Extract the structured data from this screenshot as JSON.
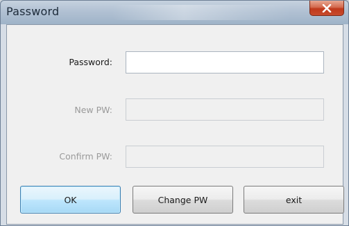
{
  "window": {
    "title": "Password"
  },
  "form": {
    "password_label": "Password:",
    "password_value": "",
    "new_pw_label": "New PW:",
    "new_pw_value": "",
    "confirm_pw_label": "Confirm PW:",
    "confirm_pw_value": ""
  },
  "buttons": {
    "ok": "OK",
    "change_pw": "Change PW",
    "exit": "exit"
  },
  "icons": {
    "close": "close-icon"
  },
  "colors": {
    "close_button": "#c0391b",
    "default_button_border": "#3c7fb1",
    "disabled_text": "#9a9a9a"
  }
}
